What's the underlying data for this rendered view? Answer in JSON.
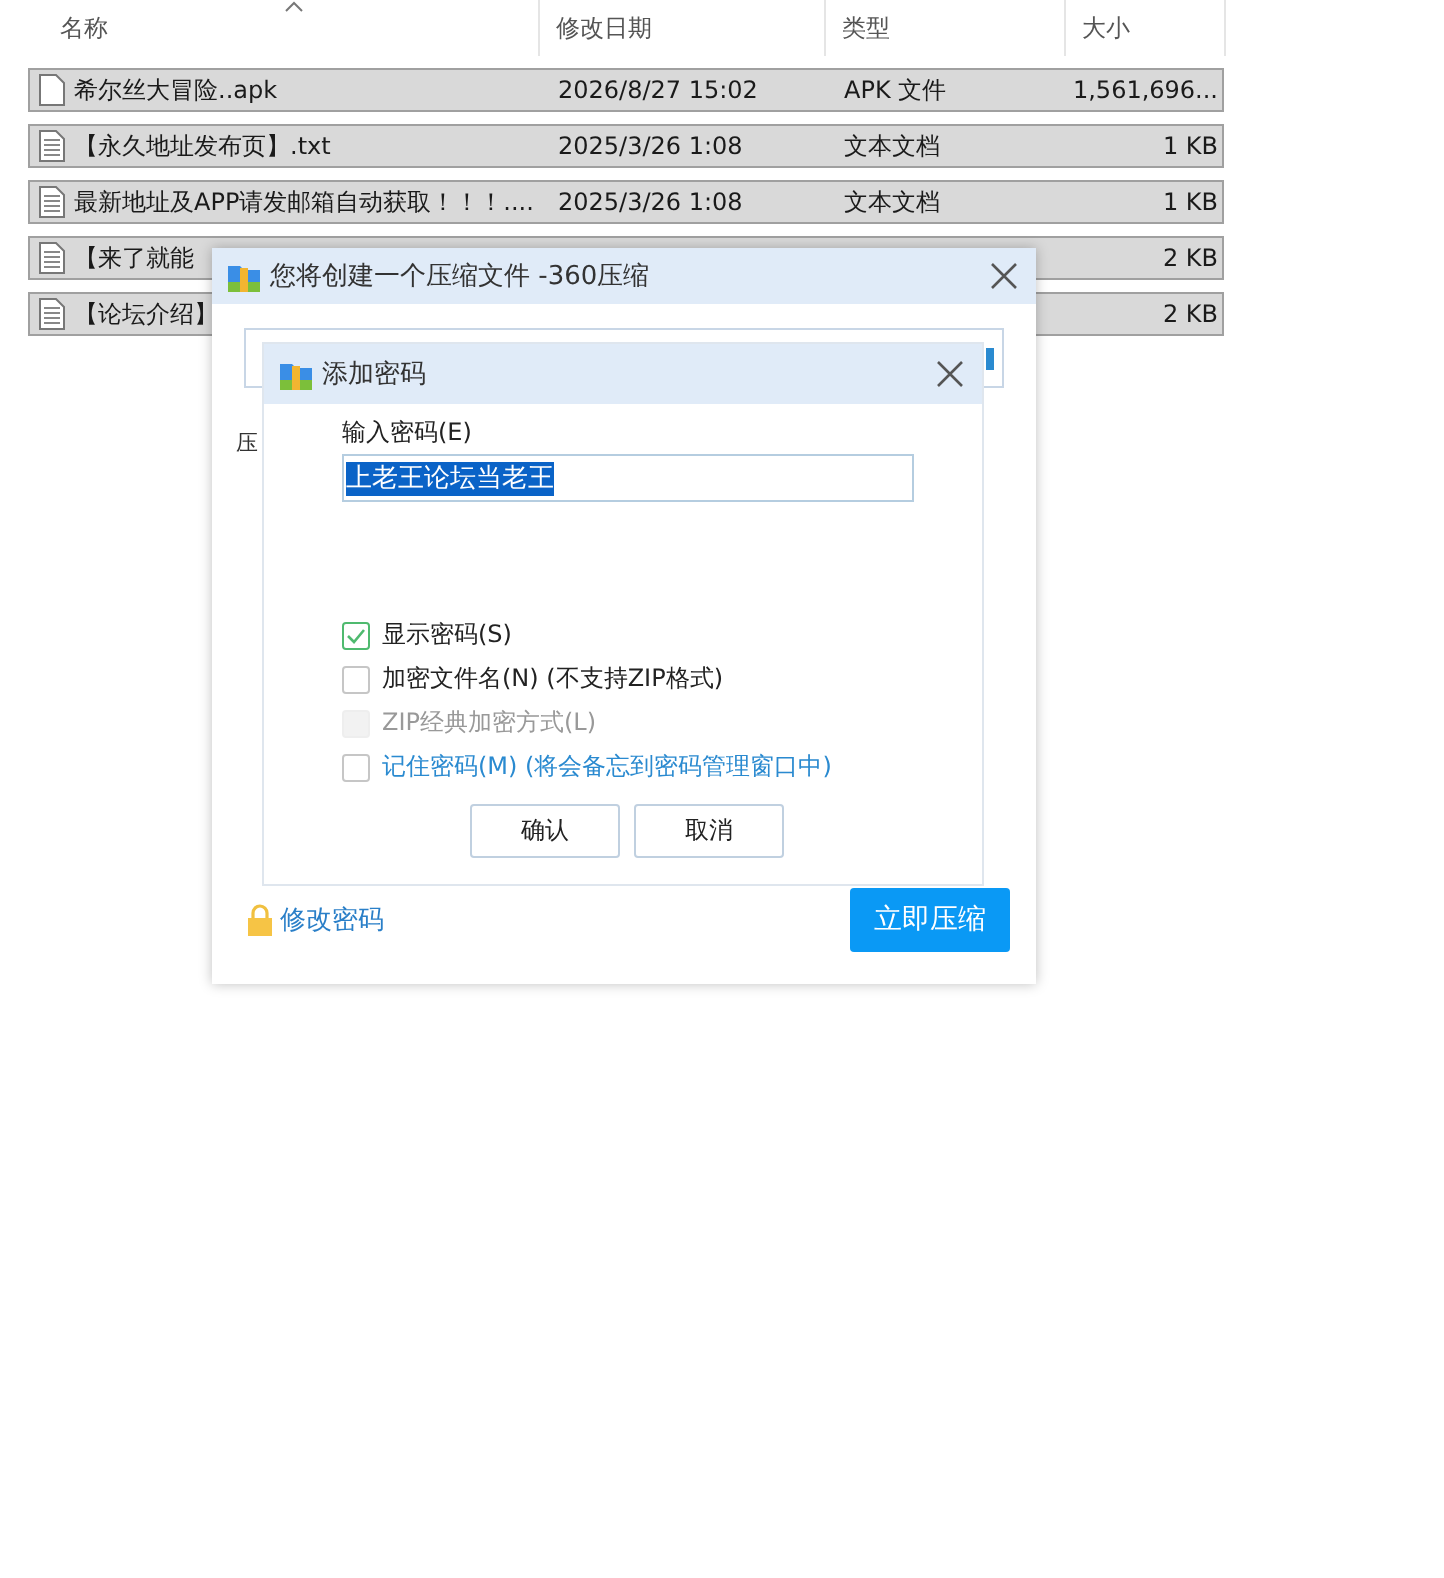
{
  "file_list": {
    "columns": [
      {
        "label": "名称",
        "sorted": true
      },
      {
        "label": "修改日期",
        "sorted": false
      },
      {
        "label": "类型",
        "sorted": false
      },
      {
        "label": "大小",
        "sorted": false
      }
    ],
    "rows": [
      {
        "kind": "file",
        "selected": true,
        "cells": [
          "希尔丝大冒险..apk",
          "2026/8/27 15:02",
          "APK 文件",
          "1,561,696..."
        ]
      },
      {
        "kind": "text",
        "selected": true,
        "cells": [
          "【永久地址发布页】.txt",
          "2025/3/26 1:08",
          "文本文档",
          "1 KB"
        ]
      },
      {
        "kind": "text",
        "selected": true,
        "cells": [
          "最新地址及APP请发邮箱自动获取！！！....",
          "2025/3/26 1:08",
          "文本文档",
          "1 KB"
        ]
      },
      {
        "kind": "text",
        "selected": true,
        "cells": [
          "【来了就能",
          "",
          "",
          "2 KB"
        ]
      },
      {
        "kind": "text",
        "selected": true,
        "cells": [
          "【论坛介绍】",
          "",
          "",
          "2 KB"
        ]
      }
    ]
  },
  "compress_dialog": {
    "title": "您将创建一个压缩文件 -360压缩",
    "label": "压",
    "change_password": "修改密码",
    "compress_button": "立即压缩"
  },
  "password_dialog": {
    "title": "添加密码",
    "field_label": "输入密码(E)",
    "password": "上老王论坛当老王",
    "options": [
      {
        "kind": "plain",
        "label": "显示密码(S)",
        "checked": true,
        "disabled": false
      },
      {
        "kind": "plain",
        "label": "加密文件名(N) (不支持ZIP格式)",
        "checked": false,
        "disabled": false
      },
      {
        "kind": "plain",
        "label": "ZIP经典加密方式(L)",
        "checked": false,
        "disabled": true
      },
      {
        "kind": "link",
        "label": "记住密码(M) (将会备忘到密码管理窗口中)",
        "checked": false,
        "disabled": false
      }
    ],
    "buttons": [
      "确认",
      "取消"
    ]
  }
}
